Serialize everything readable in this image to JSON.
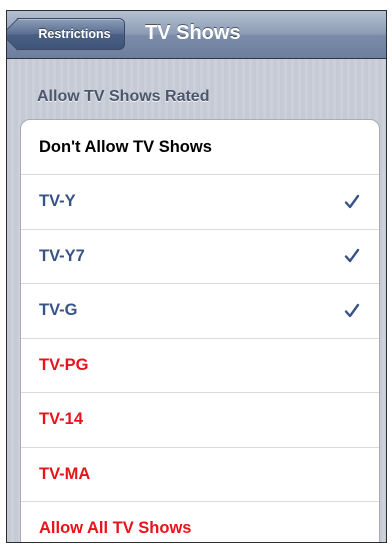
{
  "navbar": {
    "back_label": "Restrictions",
    "title": "TV Shows"
  },
  "section_header": "Allow TV Shows Rated",
  "rows": [
    {
      "label": "Don't Allow TV Shows",
      "checked": false,
      "color": "#000000"
    },
    {
      "label": "TV-Y",
      "checked": true,
      "color": "#385487"
    },
    {
      "label": "TV-Y7",
      "checked": true,
      "color": "#385487"
    },
    {
      "label": "TV-G",
      "checked": true,
      "color": "#385487"
    },
    {
      "label": "TV-PG",
      "checked": false,
      "color": "#e8131b"
    },
    {
      "label": "TV-14",
      "checked": false,
      "color": "#e8131b"
    },
    {
      "label": "TV-MA",
      "checked": false,
      "color": "#e8131b"
    },
    {
      "label": "Allow All TV Shows",
      "checked": false,
      "color": "#e8131b"
    }
  ],
  "icons": {
    "checkmark": "checkmark-icon",
    "back": "back-chevron"
  },
  "colors": {
    "navbar": "#6d7f9c",
    "checked_text": "#385487",
    "restricted_text": "#e8131b",
    "check": "#385487"
  }
}
